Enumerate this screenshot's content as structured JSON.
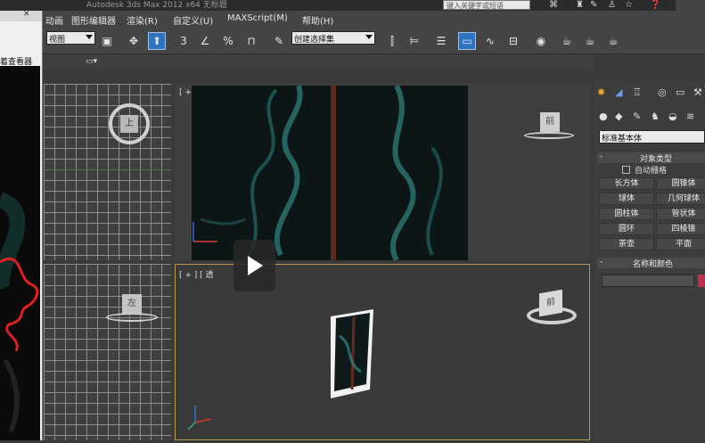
{
  "app": {
    "title": "Autodesk 3ds Max  2012 x64     无标题",
    "search_placeholder": "键入关键字或短语"
  },
  "menu": [
    "动画",
    "图形编辑器",
    "渲染(R)",
    "自定义(U)",
    "MAXScript(M)",
    "帮助(H)"
  ],
  "toolbar": {
    "view_select": "视图",
    "selection_set": "创建选择集",
    "snap_labels": [
      "3",
      "%"
    ]
  },
  "left_window": {
    "caption": "着查看器"
  },
  "viewports": {
    "front_label": "[ + ] [ 前 ] [ 真实 ]",
    "persp_label": "[ + ] [ 透",
    "top_cube_label": "上",
    "front_cube_label": "前",
    "left_cube_label": "左",
    "persp_cube_label": "前"
  },
  "command_panel": {
    "category": "标准基本体",
    "object_type_header": "对象类型",
    "autogrid_label": "自动栅格",
    "buttons": [
      "长方体",
      "圆锥体",
      "球体",
      "几何球体",
      "圆柱体",
      "管状体",
      "圆环",
      "四棱锥",
      "茶壶",
      "平面"
    ],
    "name_color_header": "名称和颜色",
    "accent_color": "#c03050"
  },
  "colors": {
    "active_button": "#2f72c0",
    "viewport_border_active": "#b89b4a"
  }
}
